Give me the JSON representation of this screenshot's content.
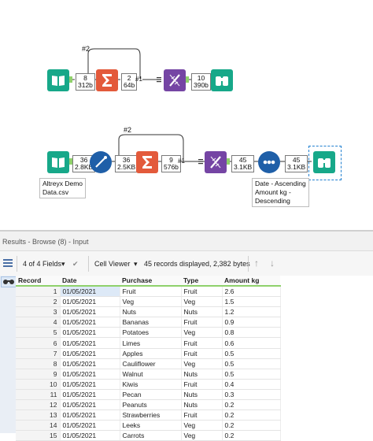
{
  "workflow1": {
    "wire_tag": "#2",
    "out_anchor": "#1",
    "counts": [
      {
        "records": "8",
        "size": "312b"
      },
      {
        "records": "2",
        "size": "64b"
      },
      {
        "records": "10",
        "size": "390b"
      }
    ]
  },
  "workflow2": {
    "wire_tag": "#2",
    "out_anchor": "#1",
    "counts": [
      {
        "records": "36",
        "size": "2.8KB"
      },
      {
        "records": "36",
        "size": "2.5KB"
      },
      {
        "records": "9",
        "size": "576b"
      },
      {
        "records": "45",
        "size": "3.1KB"
      },
      {
        "records": "45",
        "size": "3.1KB"
      }
    ],
    "input_annotation": [
      "Altreyx Demo",
      "Data.csv"
    ],
    "sort_annotation": [
      "Date - Ascending",
      "Amount kg -",
      "Descending"
    ]
  },
  "results": {
    "title": "Results - Browse (8) - Input",
    "fields_label": "4 of 4 Fields",
    "viewer_label": "Cell Viewer",
    "record_summary": "45 records displayed, 2,382 bytes",
    "columns": [
      "Record",
      "Date",
      "Purchase",
      "Type",
      "Amount kg"
    ],
    "rows": [
      [
        "1",
        "01/05/2021",
        "Fruit",
        "Fruit",
        "2.6"
      ],
      [
        "2",
        "01/05/2021",
        "Veg",
        "Veg",
        "1.5"
      ],
      [
        "3",
        "01/05/2021",
        "Nuts",
        "Nuts",
        "1.2"
      ],
      [
        "4",
        "01/05/2021",
        "Bananas",
        "Fruit",
        "0.9"
      ],
      [
        "5",
        "01/05/2021",
        "Potatoes",
        "Veg",
        "0.8"
      ],
      [
        "6",
        "01/05/2021",
        "Limes",
        "Fruit",
        "0.6"
      ],
      [
        "7",
        "01/05/2021",
        "Apples",
        "Fruit",
        "0.5"
      ],
      [
        "8",
        "01/05/2021",
        "Cauliflower",
        "Veg",
        "0.5"
      ],
      [
        "9",
        "01/05/2021",
        "Walnut",
        "Nuts",
        "0.5"
      ],
      [
        "10",
        "01/05/2021",
        "Kiwis",
        "Fruit",
        "0.4"
      ],
      [
        "11",
        "01/05/2021",
        "Pecan",
        "Nuts",
        "0.3"
      ],
      [
        "12",
        "01/05/2021",
        "Peanuts",
        "Nuts",
        "0.2"
      ],
      [
        "13",
        "01/05/2021",
        "Strawberries",
        "Fruit",
        "0.2"
      ],
      [
        "14",
        "01/05/2021",
        "Leeks",
        "Veg",
        "0.2"
      ],
      [
        "15",
        "01/05/2021",
        "Carrots",
        "Veg",
        "0.2"
      ]
    ]
  }
}
